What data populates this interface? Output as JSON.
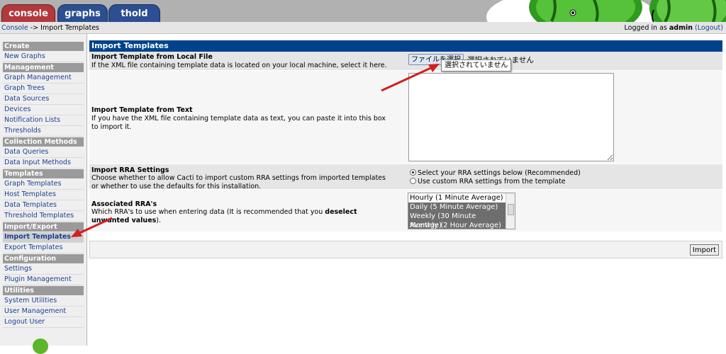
{
  "tabs": [
    "console",
    "graphs",
    "thold"
  ],
  "breadcrumb": {
    "home": "Console",
    "separator": " -> ",
    "current": "Import Templates"
  },
  "login": {
    "prefix": "Logged in as ",
    "user": "admin",
    "logout": "(Logout)"
  },
  "sidebar": {
    "sections": [
      {
        "title": "Create",
        "items": [
          "New Graphs"
        ]
      },
      {
        "title": "Management",
        "items": [
          "Graph Management",
          "Graph Trees",
          "Data Sources",
          "Devices",
          "Notification Lists",
          "Thresholds"
        ]
      },
      {
        "title": "Collection Methods",
        "items": [
          "Data Queries",
          "Data Input Methods"
        ]
      },
      {
        "title": "Templates",
        "items": [
          "Graph Templates",
          "Host Templates",
          "Data Templates",
          "Threshold Templates"
        ]
      },
      {
        "title": "Import/Export",
        "items": [
          "Import Templates",
          "Export Templates"
        ]
      },
      {
        "title": "Configuration",
        "items": [
          "Settings",
          "Plugin Management"
        ]
      },
      {
        "title": "Utilities",
        "items": [
          "System Utilities",
          "User Management",
          "Logout User"
        ]
      }
    ],
    "active_item": "Import Templates"
  },
  "page": {
    "title": "Import Templates",
    "file_section": {
      "title": "Import Template from Local File",
      "desc": "If the XML file containing template data is located on your local machine, select it here.",
      "choose_button": "ファイルを選択",
      "status": "選択されていません",
      "tooltip": "選択されていません"
    },
    "text_section": {
      "title": "Import Template from Text",
      "desc": "If you have the XML file containing template data as text, you can paste it into this box to import it."
    },
    "rra_settings": {
      "title": "Import RRA Settings",
      "desc": "Choose whether to allow Cacti to import custom RRA settings from imported templates or whether to use the defaults for this installation.",
      "options": [
        "Select your RRA settings below (Recommended)",
        "Use custom RRA settings from the template"
      ],
      "selected": 0
    },
    "associated_rra": {
      "title": "Associated RRA's",
      "desc_prefix": "Which RRA's to use when entering data (It is recommended that you ",
      "desc_bold": "deselect unwanted values",
      "desc_suffix": ").",
      "options": [
        "Hourly (1 Minute Average)",
        "Daily (5 Minute Average)",
        "Weekly (30 Minute Average)",
        "Monthly (2 Hour Average)"
      ],
      "selected": [
        false,
        true,
        true,
        true
      ]
    },
    "import_button": "Import"
  },
  "colors": {
    "console_tab": "#b3383c",
    "tab_blue": "#2c4e92",
    "title_bar": "#00438c",
    "menu_head": "#9a9a9a",
    "link": "#1b3f93",
    "arrow": "#d02020"
  }
}
